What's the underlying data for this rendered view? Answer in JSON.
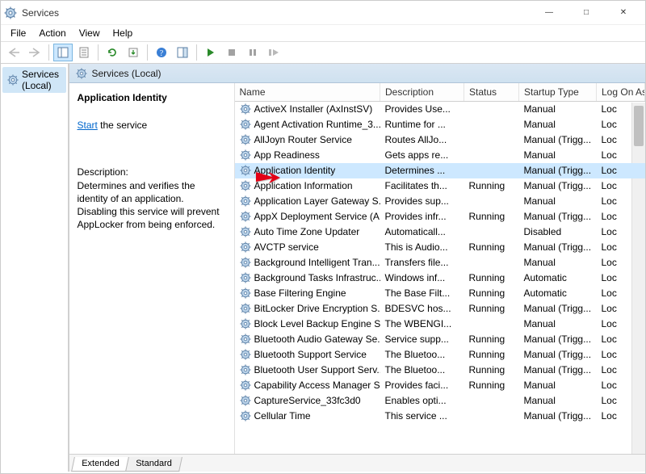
{
  "window": {
    "title": "Services",
    "btn_min": "—",
    "btn_max": "□",
    "btn_close": "✕"
  },
  "menus": [
    "File",
    "Action",
    "View",
    "Help"
  ],
  "toolbar_tips": {
    "back": "Back",
    "forward": "Forward",
    "up": "Show/Hide Console Tree",
    "props": "Properties",
    "export": "Export List",
    "refresh": "Refresh",
    "help": "Help",
    "showhide": "Show/Hide Action Pane",
    "start": "Start Service",
    "stop": "Stop Service",
    "pause": "Pause Service",
    "restart": "Restart Service"
  },
  "tree": {
    "root": "Services (Local)"
  },
  "header": {
    "label": "Services (Local)"
  },
  "details": {
    "title": "Application Identity",
    "start_label": "Start",
    "start_suffix": " the service",
    "desc_label": "Description:",
    "description": "Determines and verifies the identity of an application. Disabling this service will prevent AppLocker from being enforced."
  },
  "columns": [
    "Name",
    "Description",
    "Status",
    "Startup Type",
    "Log On As"
  ],
  "col_widths": [
    "180px",
    "104px",
    "68px",
    "96px",
    "60px"
  ],
  "selected_index": 4,
  "services": [
    {
      "name": "ActiveX Installer (AxInstSV)",
      "desc": "Provides Use...",
      "status": "",
      "startup": "Manual",
      "logon": "Loc"
    },
    {
      "name": "Agent Activation Runtime_3...",
      "desc": "Runtime for ...",
      "status": "",
      "startup": "Manual",
      "logon": "Loc"
    },
    {
      "name": "AllJoyn Router Service",
      "desc": "Routes AllJo...",
      "status": "",
      "startup": "Manual (Trigg...",
      "logon": "Loc"
    },
    {
      "name": "App Readiness",
      "desc": "Gets apps re...",
      "status": "",
      "startup": "Manual",
      "logon": "Loc"
    },
    {
      "name": "Application Identity",
      "desc": "Determines ...",
      "status": "",
      "startup": "Manual (Trigg...",
      "logon": "Loc"
    },
    {
      "name": "Application Information",
      "desc": "Facilitates th...",
      "status": "Running",
      "startup": "Manual (Trigg...",
      "logon": "Loc"
    },
    {
      "name": "Application Layer Gateway S...",
      "desc": "Provides sup...",
      "status": "",
      "startup": "Manual",
      "logon": "Loc"
    },
    {
      "name": "AppX Deployment Service (A...",
      "desc": "Provides infr...",
      "status": "Running",
      "startup": "Manual (Trigg...",
      "logon": "Loc"
    },
    {
      "name": "Auto Time Zone Updater",
      "desc": "Automaticall...",
      "status": "",
      "startup": "Disabled",
      "logon": "Loc"
    },
    {
      "name": "AVCTP service",
      "desc": "This is Audio...",
      "status": "Running",
      "startup": "Manual (Trigg...",
      "logon": "Loc"
    },
    {
      "name": "Background Intelligent Tran...",
      "desc": "Transfers file...",
      "status": "",
      "startup": "Manual",
      "logon": "Loc"
    },
    {
      "name": "Background Tasks Infrastruc...",
      "desc": "Windows inf...",
      "status": "Running",
      "startup": "Automatic",
      "logon": "Loc"
    },
    {
      "name": "Base Filtering Engine",
      "desc": "The Base Filt...",
      "status": "Running",
      "startup": "Automatic",
      "logon": "Loc"
    },
    {
      "name": "BitLocker Drive Encryption S...",
      "desc": "BDESVC hos...",
      "status": "Running",
      "startup": "Manual (Trigg...",
      "logon": "Loc"
    },
    {
      "name": "Block Level Backup Engine S...",
      "desc": "The WBENGI...",
      "status": "",
      "startup": "Manual",
      "logon": "Loc"
    },
    {
      "name": "Bluetooth Audio Gateway Se...",
      "desc": "Service supp...",
      "status": "Running",
      "startup": "Manual (Trigg...",
      "logon": "Loc"
    },
    {
      "name": "Bluetooth Support Service",
      "desc": "The Bluetoo...",
      "status": "Running",
      "startup": "Manual (Trigg...",
      "logon": "Loc"
    },
    {
      "name": "Bluetooth User Support Serv...",
      "desc": "The Bluetoo...",
      "status": "Running",
      "startup": "Manual (Trigg...",
      "logon": "Loc"
    },
    {
      "name": "Capability Access Manager S...",
      "desc": "Provides faci...",
      "status": "Running",
      "startup": "Manual",
      "logon": "Loc"
    },
    {
      "name": "CaptureService_33fc3d0",
      "desc": "Enables opti...",
      "status": "",
      "startup": "Manual",
      "logon": "Loc"
    },
    {
      "name": "Cellular Time",
      "desc": "This service ...",
      "status": "",
      "startup": "Manual (Trigg...",
      "logon": "Loc"
    }
  ],
  "tabs": {
    "extended": "Extended",
    "standard": "Standard"
  }
}
